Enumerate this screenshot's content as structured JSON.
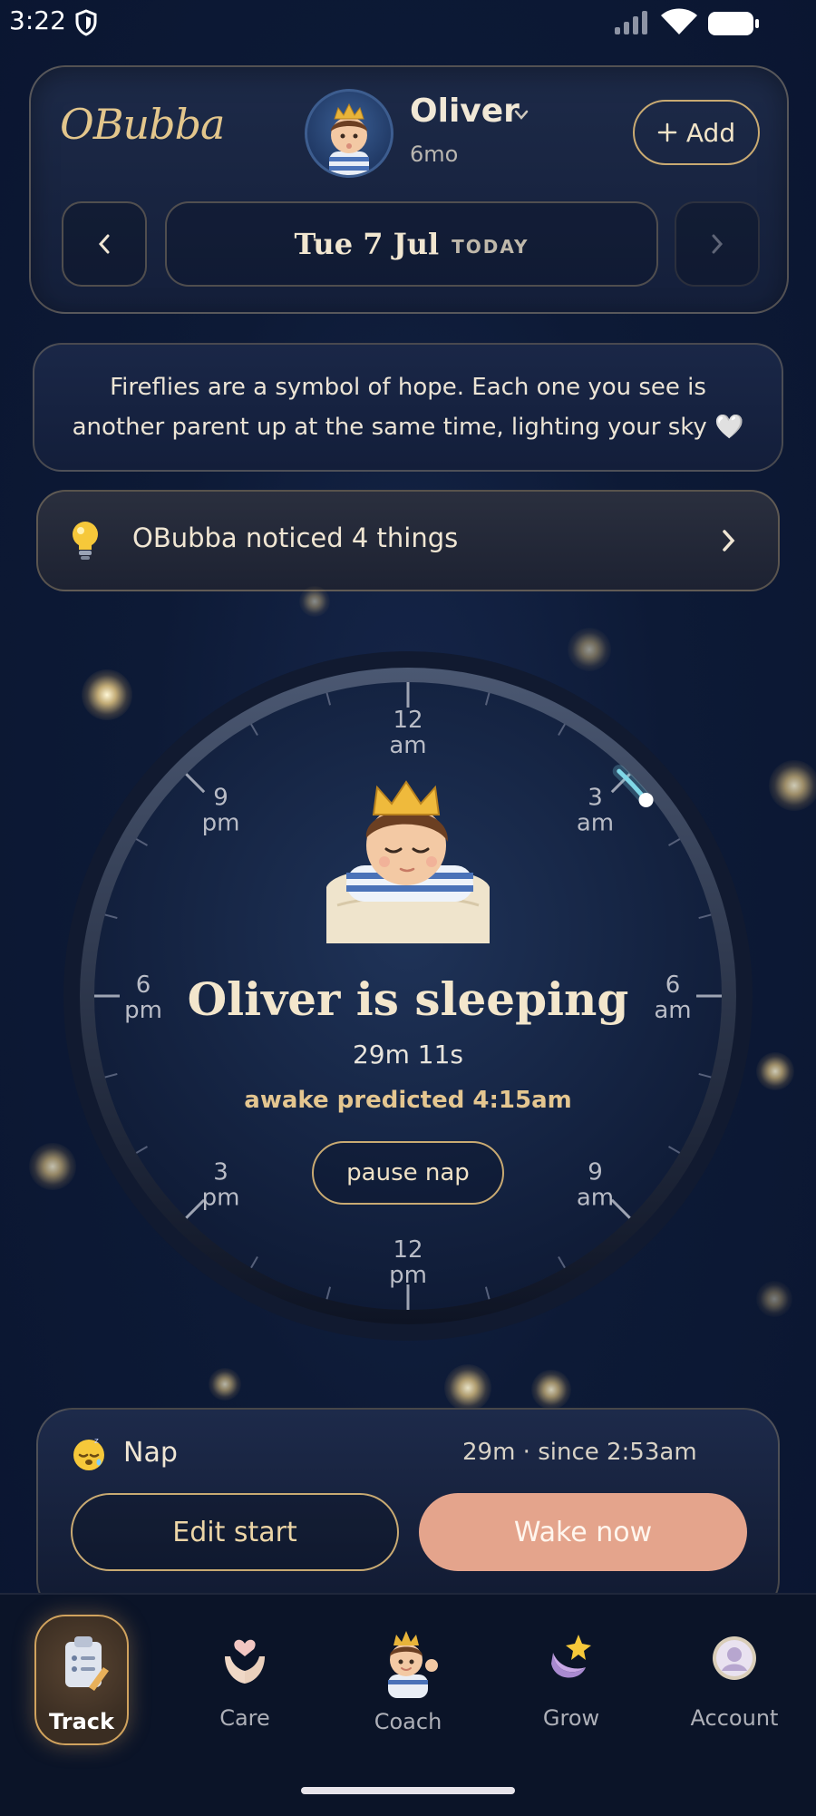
{
  "status": {
    "time": "3:22"
  },
  "header": {
    "logo": "OBubba",
    "profile_name": "Oliver",
    "profile_age": "6mo",
    "add_label": "Add",
    "date": "Tue 7 Jul",
    "today_label": "TODAY"
  },
  "quote": "Fireflies are a symbol of hope. Each one you see is another parent up at the same time, lighting your sky 🤍",
  "insight": {
    "text": "OBubba noticed 4 things"
  },
  "clock": {
    "labels": [
      {
        "hour": 0,
        "top": "12",
        "bottom": "am"
      },
      {
        "hour": 3,
        "top": "3",
        "bottom": "am"
      },
      {
        "hour": 6,
        "top": "6",
        "bottom": "am"
      },
      {
        "hour": 9,
        "top": "9",
        "bottom": "am"
      },
      {
        "hour": 12,
        "top": "12",
        "bottom": "pm"
      },
      {
        "hour": 15,
        "top": "3",
        "bottom": "pm"
      },
      {
        "hour": 18,
        "top": "6",
        "bottom": "pm"
      },
      {
        "hour": 21,
        "top": "9",
        "bottom": "pm"
      }
    ],
    "status_title": "Oliver is sleeping",
    "elapsed": "29m 11s",
    "predicted": "awake predicted 4:15am",
    "pause_label": "pause nap",
    "arc_start_hour": 2.88,
    "arc_end_hour": 3.37,
    "accent": "#7fd6e6"
  },
  "nap": {
    "label": "Nap",
    "meta": "29m · since 2:53am",
    "edit_label": "Edit start",
    "wake_label": "Wake now"
  },
  "tabs": [
    {
      "id": "track",
      "label": "Track",
      "icon": "clipboard-icon",
      "active": true
    },
    {
      "id": "care",
      "label": "Care",
      "icon": "hands-heart-icon",
      "active": false
    },
    {
      "id": "coach",
      "label": "Coach",
      "icon": "baby-coach-icon",
      "active": false
    },
    {
      "id": "grow",
      "label": "Grow",
      "icon": "moon-star-icon",
      "active": false
    },
    {
      "id": "account",
      "label": "Account",
      "icon": "account-avatar-icon",
      "active": false
    }
  ]
}
